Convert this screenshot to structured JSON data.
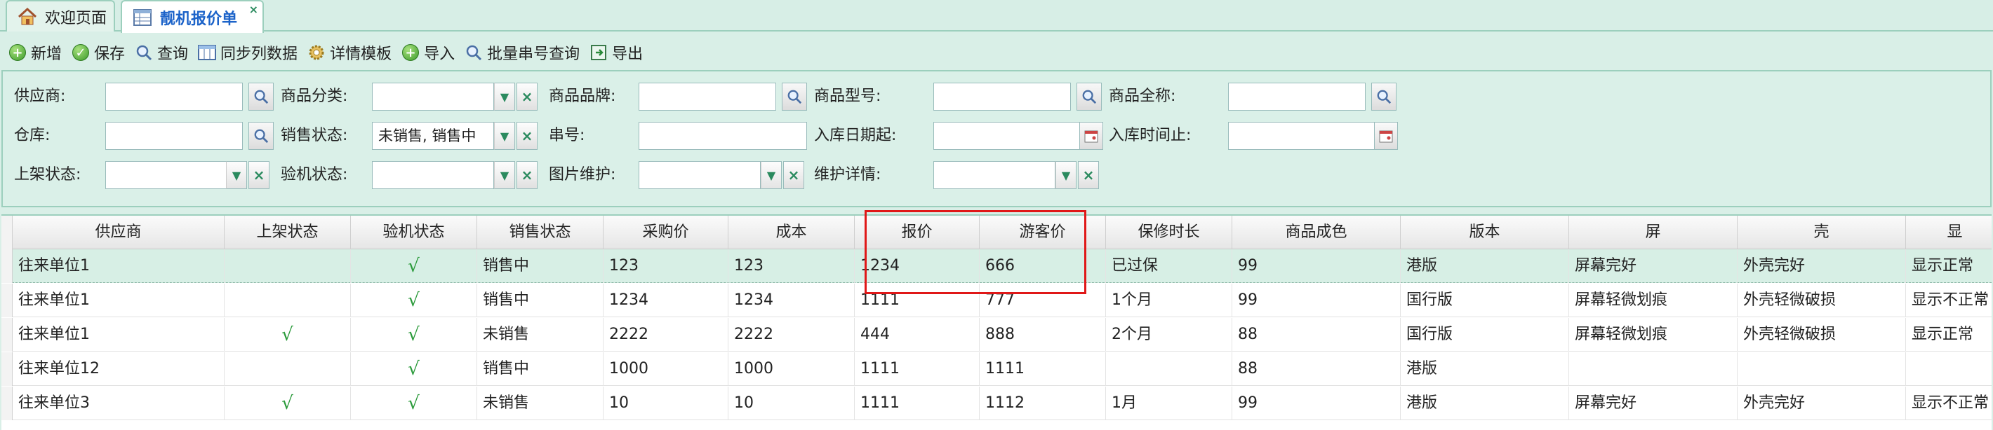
{
  "tabs": [
    {
      "label": "欢迎页面",
      "icon": "home-icon"
    },
    {
      "label": "靓机报价单",
      "icon": "table-icon",
      "close": "×"
    }
  ],
  "toolbar": {
    "add": "新增",
    "save": "保存",
    "query": "查询",
    "sync_columns": "同步列数据",
    "detail_template": "详情模板",
    "import": "导入",
    "batch_serial_query": "批量串号查询",
    "export": "导出"
  },
  "filters": {
    "supplier": {
      "label": "供应商:",
      "value": ""
    },
    "category": {
      "label": "商品分类:",
      "value": ""
    },
    "brand": {
      "label": "商品品牌:",
      "value": ""
    },
    "model": {
      "label": "商品型号:",
      "value": ""
    },
    "full_name": {
      "label": "商品全称:",
      "value": ""
    },
    "warehouse": {
      "label": "仓库:",
      "value": ""
    },
    "sales_status": {
      "label": "销售状态:",
      "value": "未销售, 销售中"
    },
    "serial": {
      "label": "串号:",
      "value": ""
    },
    "in_date_from": {
      "label": "入库日期起:",
      "value": ""
    },
    "in_date_to": {
      "label": "入库时间止:",
      "value": ""
    },
    "shelf_status": {
      "label": "上架状态:",
      "value": ""
    },
    "inspect_status": {
      "label": "验机状态:",
      "value": ""
    },
    "image_maint": {
      "label": "图片维护:",
      "value": ""
    },
    "maint_detail": {
      "label": "维护详情:",
      "value": ""
    }
  },
  "grid": {
    "columns": [
      "供应商",
      "上架状态",
      "验机状态",
      "销售状态",
      "采购价",
      "成本",
      "报价",
      "游客价",
      "保修时长",
      "商品成色",
      "版本",
      "屏",
      "壳",
      "显"
    ],
    "rows": [
      [
        "往来单位1",
        "",
        "√",
        "销售中",
        "123",
        "123",
        "1234",
        "666",
        "已过保",
        "99",
        "港版",
        "屏幕完好",
        "外壳完好",
        "显示正常"
      ],
      [
        "往来单位1",
        "",
        "√",
        "销售中",
        "1234",
        "1234",
        "1111",
        "777",
        "1个月",
        "99",
        "国行版",
        "屏幕轻微划痕",
        "外壳轻微破损",
        "显示不正常"
      ],
      [
        "往来单位1",
        "√",
        "√",
        "未销售",
        "2222",
        "2222",
        "444",
        "888",
        "2个月",
        "88",
        "国行版",
        "屏幕轻微划痕",
        "外壳轻微破损",
        "显示正常"
      ],
      [
        "往来单位12",
        "",
        "√",
        "销售中",
        "1000",
        "1000",
        "1111",
        "1111",
        "",
        "88",
        "港版",
        "",
        "",
        ""
      ],
      [
        "往来单位3",
        "√",
        "√",
        "未销售",
        "10",
        "10",
        "1111",
        "1112",
        "1月",
        "99",
        "港版",
        "屏幕完好",
        "外壳完好",
        "显示不正常"
      ]
    ]
  },
  "colors": {
    "check": "#2a9a3a",
    "highlight": "#e01818",
    "panel_bg": "#daf0e8"
  }
}
